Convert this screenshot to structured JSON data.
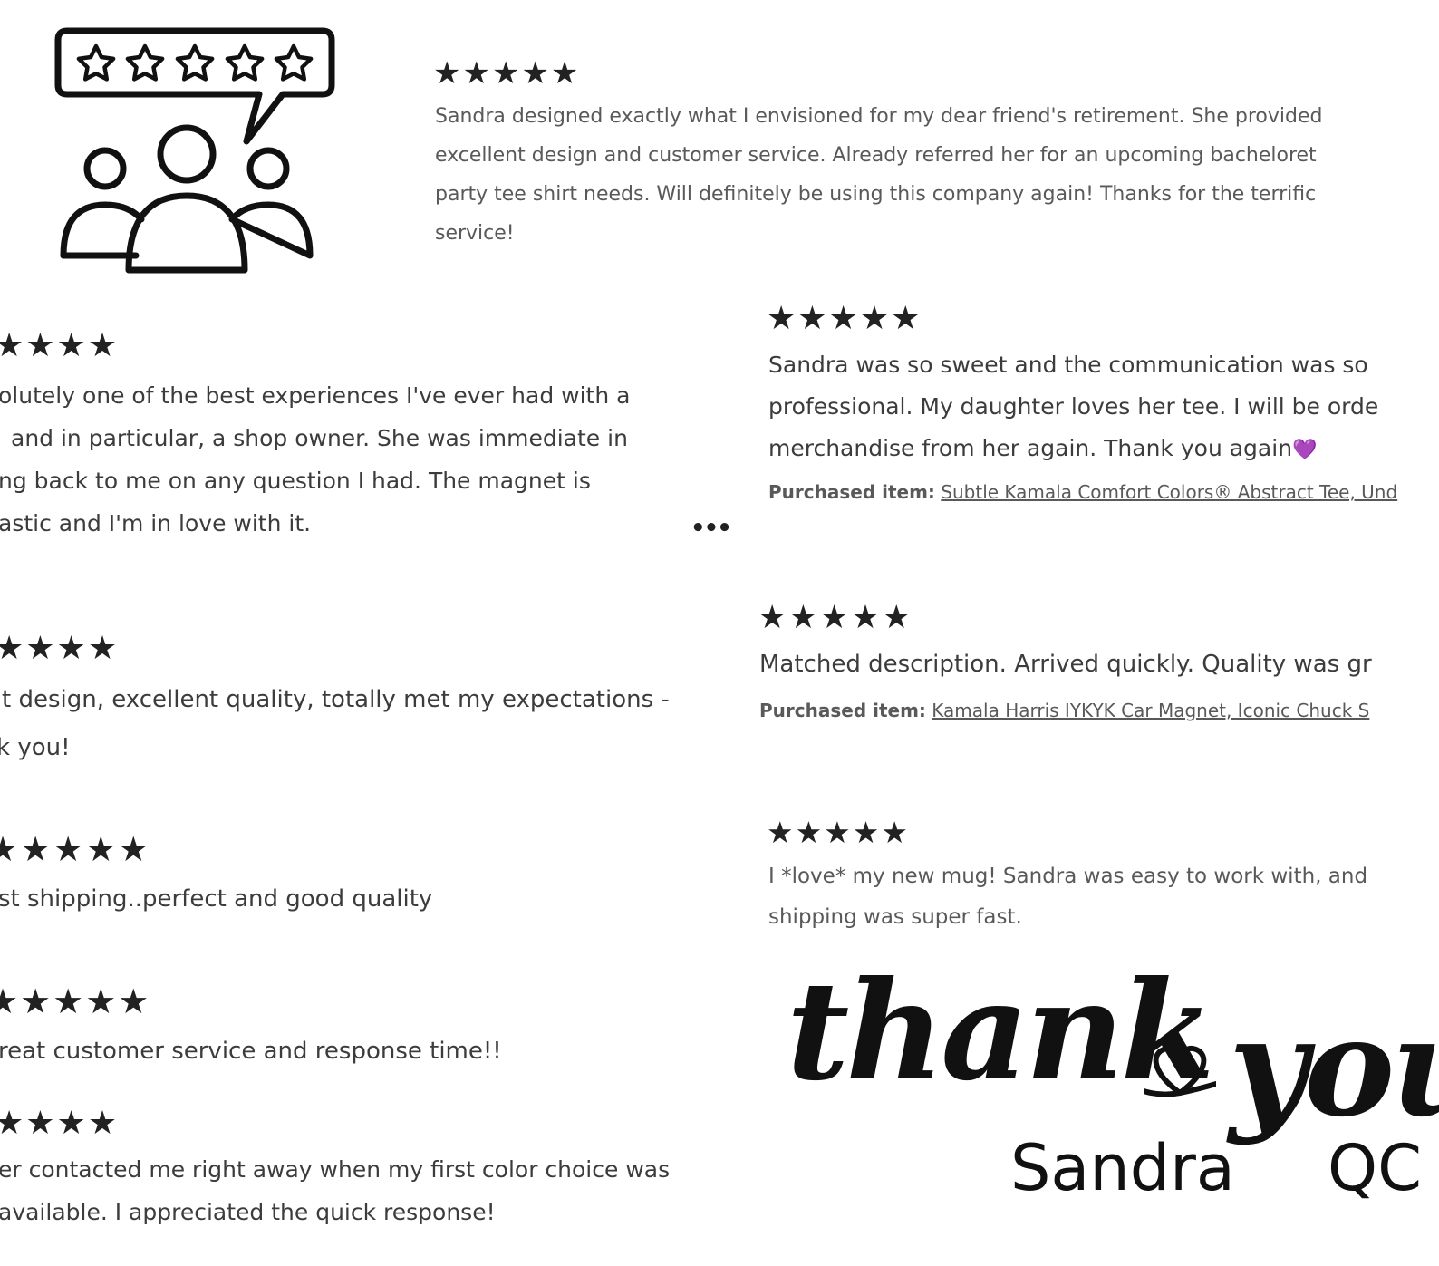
{
  "icon": {
    "name": "customer-reviews-icon",
    "rating_stars": 5
  },
  "reviews": [
    {
      "stars": "★★★★★",
      "lines": [
        "Sandra designed exactly what I envisioned for my dear friend's retirement. She provided",
        "excellent design and customer service. Already referred her for an upcoming bacheloret",
        "party tee shirt needs. Will definitely be using this company again! Thanks for the terrific",
        "service!"
      ]
    },
    {
      "stars": "★★★★",
      "lines": [
        "olutely one of the best experiences I've ever had with a",
        "and in particular, a shop owner. She was immediate in",
        "ng back to me on any question I had. The magnet is",
        "astic and I'm in love with it."
      ],
      "more": "•••"
    },
    {
      "stars": "★★★★★",
      "lines": [
        "Sandra was so sweet and the communication was so",
        "professional. My daughter loves her tee. I will be orde",
        "merchandise from her again. Thank you again"
      ],
      "emoji": "💜",
      "purchased_label": "Purchased item:",
      "purchased_item": "Subtle Kamala Comfort Colors® Abstract Tee, Und"
    },
    {
      "stars": "★★★★",
      "lines": [
        "t design, excellent quality, totally met my expectations -",
        "k you!"
      ]
    },
    {
      "stars": "★★★★★",
      "lines": [
        "Matched description. Arrived quickly. Quality was gr"
      ],
      "purchased_label": "Purchased item:",
      "purchased_item": "Kamala Harris IYKYK Car Magnet, Iconic Chuck S"
    },
    {
      "stars": "★★★★★",
      "lines": [
        "st shipping..perfect and good quality"
      ]
    },
    {
      "stars": "★★★★★",
      "lines": [
        "I *love* my new mug! Sandra was easy to work with, and",
        "shipping was super fast."
      ]
    },
    {
      "stars": "★★★★★",
      "lines": [
        "reat customer service and response time!!"
      ]
    },
    {
      "stars": "★★★★",
      "lines": [
        "er contacted me right away when my first color choice was",
        "available. I appreciated the quick response!"
      ]
    }
  ],
  "signoff": {
    "thank": "thank",
    "you": "you",
    "name": "Sandra",
    "initials": "QC"
  },
  "colors": {
    "text": "#595959",
    "stars": "#222222",
    "heart_emoji": "#8a4fd8"
  }
}
